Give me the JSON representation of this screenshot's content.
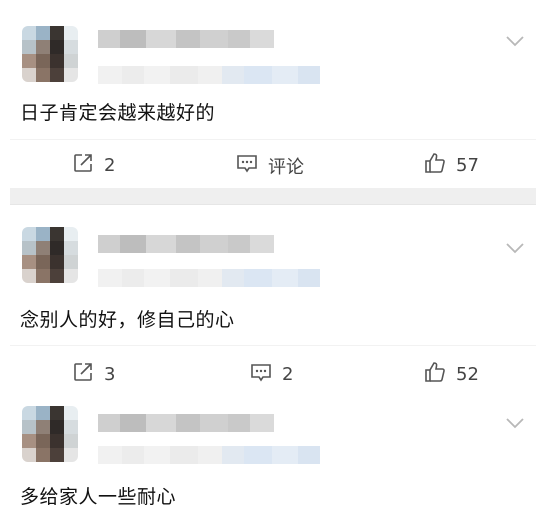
{
  "comments": [
    {
      "content": "日子肯定会越来越好的",
      "actions": {
        "repost_count": "2",
        "comment_label": "评论",
        "like_count": "57"
      }
    },
    {
      "content": "念别人的好，修自己的心",
      "actions": {
        "repost_count": "3",
        "comment_count": "2",
        "like_count": "52"
      }
    },
    {
      "content": "多给家人一些耐心"
    }
  ],
  "icons": {
    "repost": "repost-icon",
    "comment": "comment-icon",
    "like": "thumbs-up-icon",
    "menu": "chevron-down-icon"
  },
  "colors": {
    "text": "#111111",
    "muted": "#444444",
    "separator": "#efefef",
    "blur_gray": "#d8d8d8",
    "blur_blue": "#dbe6f3"
  }
}
